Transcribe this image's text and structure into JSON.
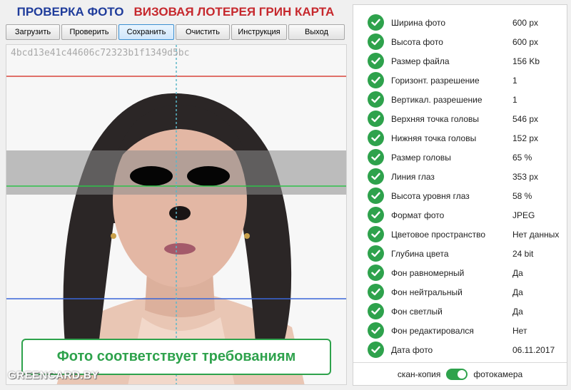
{
  "header": {
    "title_left": "ПРОВЕРКА ФОТО",
    "title_right": "ВИЗОВАЯ ЛОТЕРЕЯ ГРИН КАРТА",
    "color_left": "#1f3c9b",
    "color_right": "#c6282d"
  },
  "toolbar": {
    "load": "Загрузить",
    "check": "Проверить",
    "save": "Сохранить",
    "clear": "Очистить",
    "instruction": "Инструкция",
    "exit": "Выход"
  },
  "photo": {
    "hash": "4bcd13e41c44606c72323b1f1349d5bc",
    "verdict": "Фото соответствует требованиям",
    "watermark": "GREENCARD.BY",
    "guide_colors": {
      "top": "#d9453b",
      "eyes": "#2ec24a",
      "chin": "#3a66d8",
      "center": "#5bb7c9"
    }
  },
  "results": [
    {
      "label": "Ширина фото",
      "value": "600 px"
    },
    {
      "label": "Высота фото",
      "value": "600 px"
    },
    {
      "label": "Размер файла",
      "value": "156 Kb"
    },
    {
      "label": "Горизонт. разрешение",
      "value": "1"
    },
    {
      "label": "Вертикал. разрешение",
      "value": "1"
    },
    {
      "label": "Верхняя точка головы",
      "value": "546 px"
    },
    {
      "label": "Нижняя точка головы",
      "value": "152 px"
    },
    {
      "label": "Размер головы",
      "value": "65 %"
    },
    {
      "label": "Линия глаз",
      "value": "353 px"
    },
    {
      "label": "Высота уровня глаз",
      "value": "58 %"
    },
    {
      "label": "Формат фото",
      "value": "JPEG"
    },
    {
      "label": "Цветовое пространство",
      "value": "Нет данных"
    },
    {
      "label": "Глубина цвета",
      "value": "24 bit"
    },
    {
      "label": "Фон равномерный",
      "value": "Да"
    },
    {
      "label": "Фон нейтральный",
      "value": "Да"
    },
    {
      "label": "Фон светлый",
      "value": "Да"
    },
    {
      "label": "Фон редактировался",
      "value": "Нет"
    },
    {
      "label": "Дата фото",
      "value": "06.11.2017"
    }
  ],
  "footer": {
    "left_label": "скан-копия",
    "right_label": "фотокамера",
    "toggle_on": true
  },
  "accent_color": "#2ea24c"
}
